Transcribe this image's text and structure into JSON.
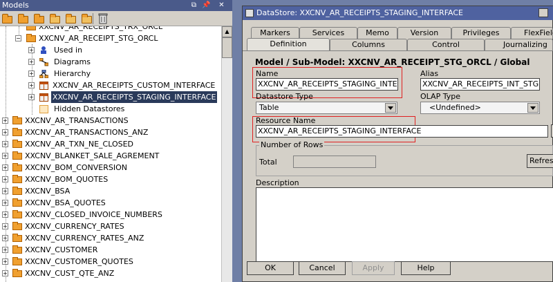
{
  "left_panel": {
    "title": "Models",
    "controls": [
      "⧉",
      "📌",
      "✕"
    ],
    "tree": [
      {
        "label": "XXCNV_AR_RECEIPTS_TRX_ORCL",
        "level": 2,
        "icon": "folder"
      },
      {
        "label": "XXCNV_AR_RECEIPT_STG_ORCL",
        "level": 2,
        "icon": "folder"
      },
      {
        "label": "Used in",
        "level": 3,
        "icon": "user"
      },
      {
        "label": "Diagrams",
        "level": 3,
        "icon": "diagram"
      },
      {
        "label": "Hierarchy",
        "level": 3,
        "icon": "hierarchy"
      },
      {
        "label": "XXCNV_AR_RECEIPTS_CUSTOM_INTERFACE",
        "level": 3,
        "icon": "table"
      },
      {
        "label": "XXCNV_AR_RECEIPTS_STAGING_INTERFACE",
        "level": 3,
        "icon": "table"
      },
      {
        "label": "Hidden Datastores",
        "level": 3,
        "icon": "hidden"
      },
      {
        "label": "XXCNV_AR_TRANSACTIONS",
        "level": 0,
        "icon": "folder"
      },
      {
        "label": "XXCNV_AR_TRANSACTIONS_ANZ",
        "level": 0,
        "icon": "folder"
      },
      {
        "label": "XXCNV_AR_TXN_NE_CLOSED",
        "level": 0,
        "icon": "folder"
      },
      {
        "label": "XXCNV_BLANKET_SALE_AGREMENT",
        "level": 0,
        "icon": "folder"
      },
      {
        "label": "XXCNV_BOM_CONVERSION",
        "level": 0,
        "icon": "folder"
      },
      {
        "label": "XXCNV_BOM_QUOTES",
        "level": 0,
        "icon": "folder"
      },
      {
        "label": "XXCNV_BSA",
        "level": 0,
        "icon": "folder"
      },
      {
        "label": "XXCNV_BSA_QUOTES",
        "level": 0,
        "icon": "folder"
      },
      {
        "label": "XXCNV_CLOSED_INVOICE_NUMBERS",
        "level": 0,
        "icon": "folder"
      },
      {
        "label": "XXCNV_CURRENCY_RATES",
        "level": 0,
        "icon": "folder"
      },
      {
        "label": "XXCNV_CURRENCY_RATES_ANZ",
        "level": 0,
        "icon": "folder"
      },
      {
        "label": "XXCNV_CUSTOMER",
        "level": 0,
        "icon": "folder"
      },
      {
        "label": "XXCNV_CUSTOMER_QUOTES",
        "level": 0,
        "icon": "folder"
      },
      {
        "label": "XXCNV_CUST_QTE_ANZ",
        "level": 0,
        "icon": "folder"
      }
    ]
  },
  "dialog": {
    "title": "DataStore: XXCNV_AR_RECEIPTS_STAGING_INTERFACE",
    "tabs_row1": [
      "Markers",
      "Services",
      "Memo",
      "Version",
      "Privileges",
      "FlexFields"
    ],
    "tabs_row2": [
      "Definition",
      "Columns",
      "Control",
      "Journalizing"
    ],
    "heading": "Model / Sub-Model: XXCNV_AR_RECEIPT_STG_ORCL / Global",
    "name_label": "Name",
    "name_value": "XXCNV_AR_RECEIPTS_STAGING_INTERFACE",
    "alias_label": "Alias",
    "alias_value": "XXCNV_AR_RECEIPTS_INT_STG",
    "datastore_type_label": "Datastore Type",
    "datastore_type_value": "Table",
    "olap_type_label": "OLAP Type",
    "olap_type_value": "<Undefined>",
    "resource_name_label": "Resource Name",
    "resource_name_value": "XXCNV_AR_RECEIPTS_STAGING_INTERFACE",
    "number_of_rows_label": "Number of Rows",
    "total_label": "Total",
    "total_value": "",
    "refresh_label": "Refresh",
    "description_label": "Description",
    "description_value": "",
    "buttons": {
      "ok": "OK",
      "cancel": "Cancel",
      "apply": "Apply",
      "help": "Help"
    }
  }
}
